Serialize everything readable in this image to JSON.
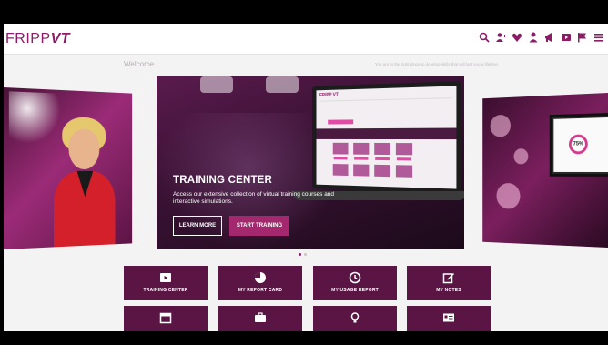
{
  "header": {
    "logo_prefix": "FRIPP",
    "logo_suffix": "VT",
    "icons": [
      "search-icon",
      "user-add-icon",
      "heart-icon",
      "person-icon",
      "megaphone-icon",
      "video-icon",
      "flag-icon",
      "menu-icon"
    ]
  },
  "welcome": "Welcome.",
  "tagline": "You are in the right place to develop skills that will last you a lifetime.",
  "hero": {
    "title": "TRAINING CENTER",
    "description": "Access our extensive collection of virtual training courses and interactive simulations.",
    "learn_more": "LEARN MORE",
    "start_training": "START TRAINING",
    "laptop_logo": "FRIPP VT",
    "badge": "75%"
  },
  "tiles": [
    {
      "label": "TRAINING CENTER",
      "icon": "play-icon"
    },
    {
      "label": "MY REPORT CARD",
      "icon": "pie-chart-icon"
    },
    {
      "label": "MY USAGE REPORT",
      "icon": "clock-icon"
    },
    {
      "label": "MY NOTES",
      "icon": "edit-icon"
    },
    {
      "label": "",
      "icon": "calendar-icon"
    },
    {
      "label": "",
      "icon": "briefcase-icon"
    },
    {
      "label": "",
      "icon": "lightbulb-icon"
    },
    {
      "label": "",
      "icon": "id-card-icon"
    }
  ],
  "colors": {
    "brand": "#8b1d66",
    "tile": "#5a1545",
    "button": "#a3286d"
  }
}
